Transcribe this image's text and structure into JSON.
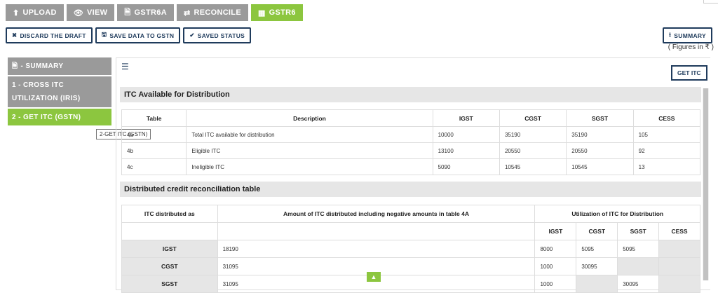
{
  "tabs": [
    {
      "label": "UPLOAD",
      "icon": "upload-icon",
      "glyph": "⬆"
    },
    {
      "label": "VIEW",
      "icon": "eye-icon",
      "glyph": "👁"
    },
    {
      "label": "GSTR6A",
      "icon": "document-icon",
      "glyph": "🗎"
    },
    {
      "label": "RECONCILE",
      "icon": "exchange-icon",
      "glyph": "⇄"
    },
    {
      "label": "GSTR6",
      "icon": "grid-icon",
      "glyph": "▦"
    }
  ],
  "actions": {
    "discard": "DISCARD THE DRAFT",
    "save": "SAVE DATA TO GSTN",
    "saved_status": "SAVED STATUS",
    "summary": "SUMMARY",
    "figures": "( Figures in ₹ )"
  },
  "sidebar": {
    "items": [
      {
        "label": "- SUMMARY"
      },
      {
        "label": "1 - CROSS ITC UTILIZATION (IRIS)"
      },
      {
        "label": "2 - GET ITC (GSTN)"
      }
    ],
    "tooltip": "2-GET ITC (GSTN)"
  },
  "main": {
    "get_itc": "GET ITC",
    "section1": "ITC Available for Distribution",
    "table1": {
      "headers": [
        "Table",
        "Description",
        "IGST",
        "CGST",
        "SGST",
        "CESS"
      ],
      "rows": [
        [
          "4a",
          "Total ITC available for distribution",
          "10000",
          "35190",
          "35190",
          "105"
        ],
        [
          "4b",
          "Eligible ITC",
          "13100",
          "20550",
          "20550",
          "92"
        ],
        [
          "4c",
          "Ineligible ITC",
          "5090",
          "10545",
          "10545",
          "13"
        ]
      ]
    },
    "section2": "Distributed credit reconciliation table",
    "table2": {
      "h_distributed": "ITC distributed as",
      "h_amount": "Amount of ITC distributed including negative amounts in table 4A",
      "h_util": "Utilization of ITC for Distribution",
      "sub": [
        "IGST",
        "CGST",
        "SGST",
        "CESS"
      ],
      "rows": [
        {
          "label": "IGST",
          "amount": "18190",
          "igst": "8000",
          "cgst": "5095",
          "sgst": "5095",
          "cess": ""
        },
        {
          "label": "CGST",
          "amount": "31095",
          "igst": "1000",
          "cgst": "30095",
          "sgst": "",
          "cess": ""
        },
        {
          "label": "SGST",
          "amount": "31095",
          "igst": "1000",
          "cgst": "",
          "sgst": "30095",
          "cess": ""
        }
      ]
    }
  },
  "colors": {
    "accent": "#8cc63f",
    "tab": "#9a9a9a",
    "navy": "#1f3b5c"
  }
}
